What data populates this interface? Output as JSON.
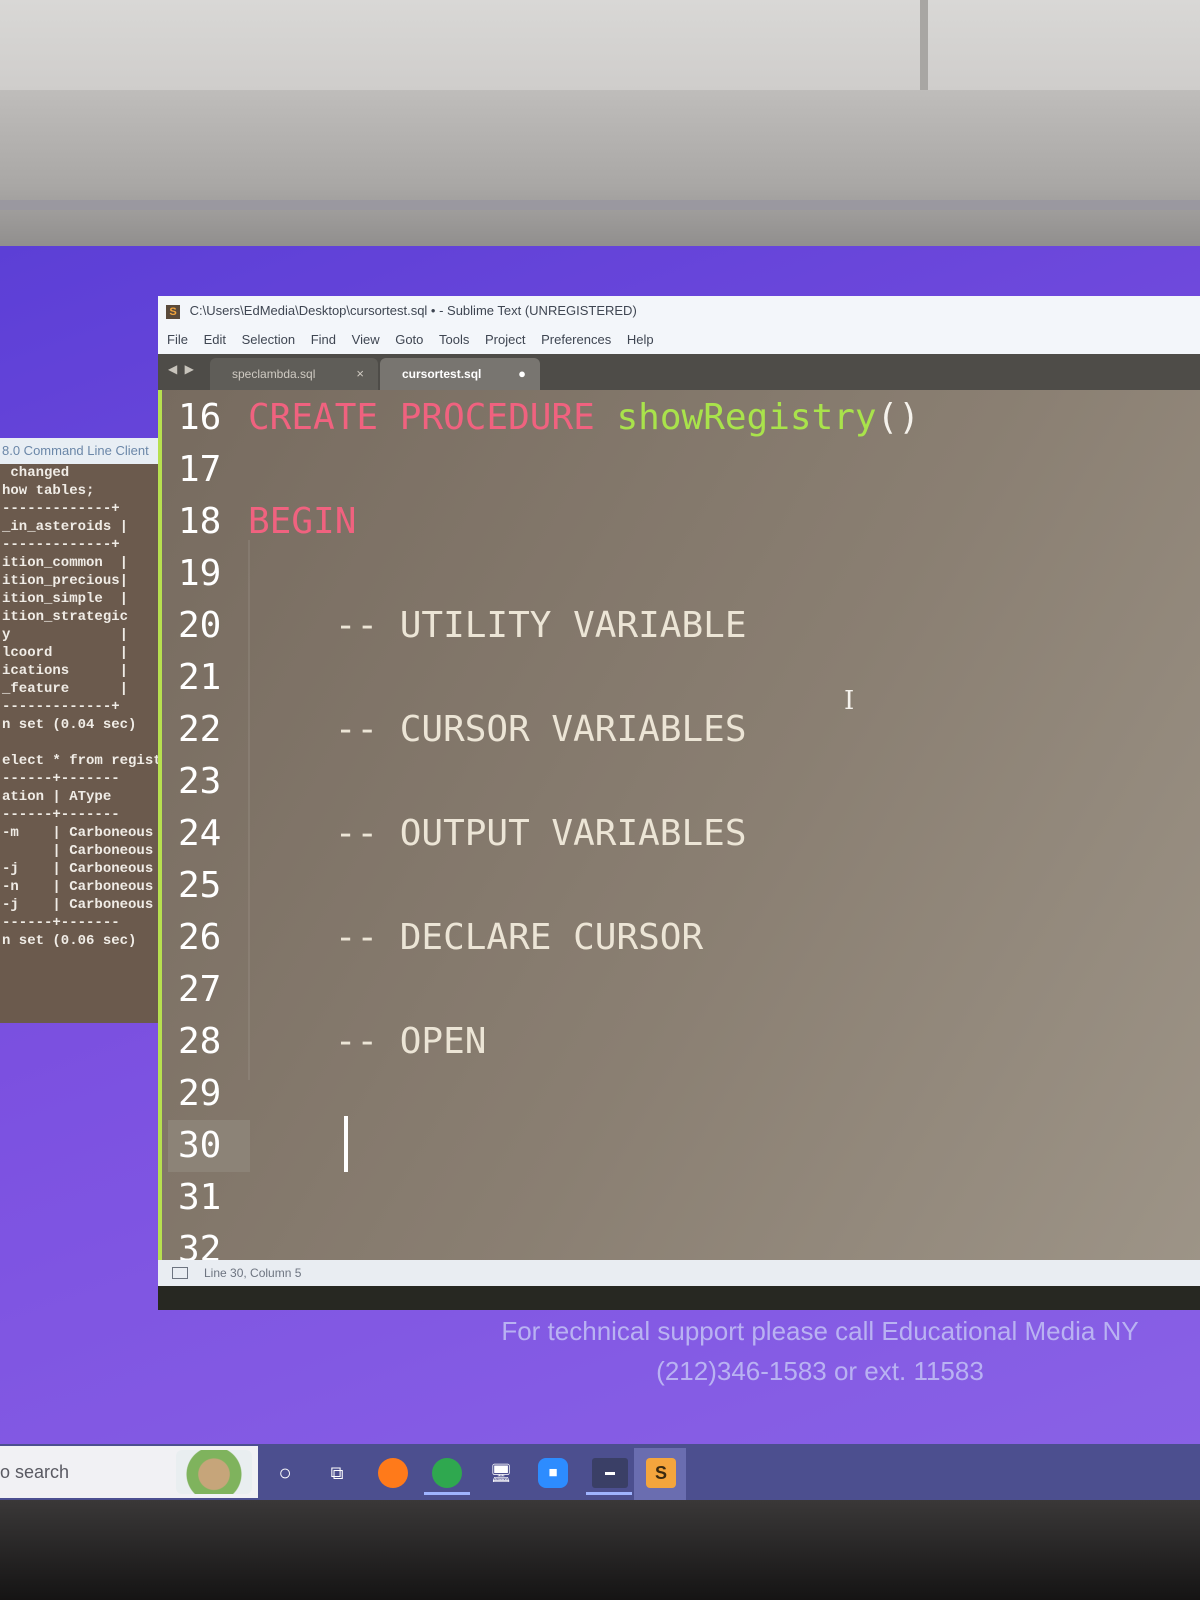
{
  "sublime": {
    "title": "C:\\Users\\EdMedia\\Desktop\\cursortest.sql • - Sublime Text (UNREGISTERED)",
    "menu": [
      "File",
      "Edit",
      "Selection",
      "Find",
      "View",
      "Goto",
      "Tools",
      "Project",
      "Preferences",
      "Help"
    ],
    "tabs": [
      {
        "label": "speclambda.sql",
        "marker": "×"
      },
      {
        "label": "cursortest.sql",
        "marker": "●"
      }
    ],
    "lines": [
      {
        "num": "16",
        "text": ""
      },
      {
        "num": "17",
        "text": ""
      },
      {
        "num": "18",
        "text": "BEGIN"
      },
      {
        "num": "19",
        "text": ""
      },
      {
        "num": "20",
        "text": "    -- UTILITY VARIABLE"
      },
      {
        "num": "21",
        "text": ""
      },
      {
        "num": "22",
        "text": "    -- CURSOR VARIABLES"
      },
      {
        "num": "23",
        "text": ""
      },
      {
        "num": "24",
        "text": "    -- OUTPUT VARIABLES"
      },
      {
        "num": "25",
        "text": ""
      },
      {
        "num": "26",
        "text": "    -- DECLARE CURSOR"
      },
      {
        "num": "27",
        "text": ""
      },
      {
        "num": "28",
        "text": "    -- OPEN"
      },
      {
        "num": "29",
        "text": ""
      },
      {
        "num": "30",
        "text": ""
      },
      {
        "num": "31",
        "text": ""
      },
      {
        "num": "32",
        "text": ""
      }
    ],
    "line16_parts": {
      "kw1": "CREATE",
      "kw2": "PROCEDURE",
      "fn": "showRegistry",
      "paren": "()"
    },
    "status": "Line 30, Column 5"
  },
  "console": {
    "title": "8.0 Command Line Client",
    "lines": [
      " changed",
      "how tables;",
      "-------------+",
      "_in_asteroids |",
      "-------------+",
      "ition_common  |",
      "ition_precious|",
      "ition_simple  |",
      "ition_strategic",
      "y             |",
      "lcoord        |",
      "ications      |",
      "_feature      |",
      "-------------+",
      "n set (0.04 sec)",
      "",
      "elect * from registr",
      "------+-------",
      "ation | AType",
      "------+-------",
      "-m    | Carboneous",
      "      | Carboneous",
      "-j    | Carboneous",
      "-n    | Carboneous",
      "-j    | Carboneous",
      "------+-------",
      "n set (0.06 sec)"
    ]
  },
  "support": {
    "line1": "For technical support please call Educational Media NY",
    "line2": "(212)346-1583 or ext. 11583"
  },
  "taskbar": {
    "search_text": "o search",
    "colors": {
      "firefox": "#ff7a1a",
      "chrome": "#2fa84f",
      "zoom": "#2d8cff",
      "sublime": "#f4a53d"
    }
  }
}
